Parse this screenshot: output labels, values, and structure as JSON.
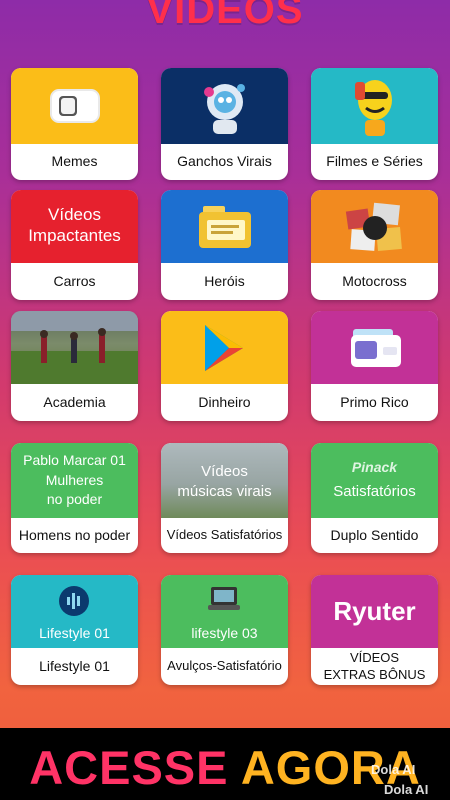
{
  "header": {
    "title": "VÍDEOS"
  },
  "colors": {
    "yellow": "#fbbd18",
    "navy": "#0b2f66",
    "teal": "#25b9c6",
    "red": "#e6212e",
    "blue": "#1d6fd0",
    "orange": "#f28a1f",
    "magenta": "#c23197",
    "green": "#4cbd5e",
    "grey": "#9aa8a4"
  },
  "cards": [
    {
      "label": "Memes"
    },
    {
      "label": "Ganchos Virais"
    },
    {
      "label": "Filmes e Séries"
    },
    {
      "label": "Carros",
      "art_text": "Vídeos Impactantes"
    },
    {
      "label": "Heróis"
    },
    {
      "label": "Motocross"
    },
    {
      "label": "Academia"
    },
    {
      "label": "Dinheiro"
    },
    {
      "label": "Primo Rico"
    },
    {
      "label": "Homens no poder",
      "art_line1": "Pablo Marcar 01",
      "art_line2": "Mulheres",
      "art_line3": "no poder"
    },
    {
      "label": "Vídeos Satisfatórios",
      "art_line1": "Vídeos",
      "art_line2": "músicas virais"
    },
    {
      "label": "Duplo Sentido",
      "art_line1": "Pinack",
      "art_line2": "Satisfatórios"
    },
    {
      "label": "Lifestyle 01",
      "art_text": "Lifestyle 01"
    },
    {
      "label": "Avulços-Satisfatório",
      "art_text": "lifestyle 03"
    },
    {
      "label_line1": "VÍDEOS",
      "label_line2": "EXTRAS BÔNUS",
      "art_text": "Ryuter"
    }
  ],
  "cta": {
    "part1": "ACESSE",
    "part2": "AGORA"
  },
  "watermarks": [
    "Dola AI",
    "Dola AI"
  ]
}
